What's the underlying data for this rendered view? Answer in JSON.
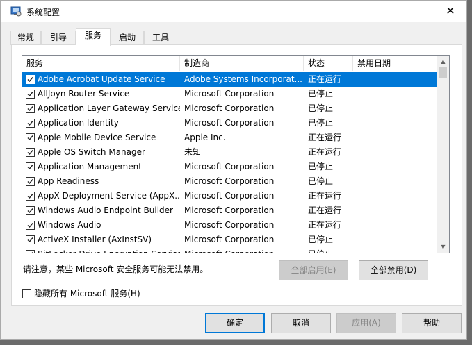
{
  "window": {
    "title": "系统配置",
    "close_glyph": "✕"
  },
  "tabs": [
    {
      "label": "常规",
      "active": false
    },
    {
      "label": "引导",
      "active": false
    },
    {
      "label": "服务",
      "active": true
    },
    {
      "label": "启动",
      "active": false
    },
    {
      "label": "工具",
      "active": false
    }
  ],
  "services": {
    "columns": [
      "服务",
      "制造商",
      "状态",
      "禁用日期"
    ],
    "rows": [
      {
        "checked": true,
        "name": "Adobe Acrobat Update Service",
        "manufacturer": "Adobe Systems Incorporat...",
        "status": "正在运行",
        "date": "",
        "selected": true
      },
      {
        "checked": true,
        "name": "AllJoyn Router Service",
        "manufacturer": "Microsoft Corporation",
        "status": "已停止",
        "date": ""
      },
      {
        "checked": true,
        "name": "Application Layer Gateway Service",
        "manufacturer": "Microsoft Corporation",
        "status": "已停止",
        "date": ""
      },
      {
        "checked": true,
        "name": "Application Identity",
        "manufacturer": "Microsoft Corporation",
        "status": "已停止",
        "date": ""
      },
      {
        "checked": true,
        "name": "Apple Mobile Device Service",
        "manufacturer": "Apple Inc.",
        "status": "正在运行",
        "date": ""
      },
      {
        "checked": true,
        "name": "Apple OS Switch Manager",
        "manufacturer": "未知",
        "status": "正在运行",
        "date": ""
      },
      {
        "checked": true,
        "name": "Application Management",
        "manufacturer": "Microsoft Corporation",
        "status": "已停止",
        "date": ""
      },
      {
        "checked": true,
        "name": "App Readiness",
        "manufacturer": "Microsoft Corporation",
        "status": "已停止",
        "date": ""
      },
      {
        "checked": true,
        "name": "AppX Deployment Service (AppX...",
        "manufacturer": "Microsoft Corporation",
        "status": "正在运行",
        "date": ""
      },
      {
        "checked": true,
        "name": "Windows Audio Endpoint Builder",
        "manufacturer": "Microsoft Corporation",
        "status": "正在运行",
        "date": ""
      },
      {
        "checked": true,
        "name": "Windows Audio",
        "manufacturer": "Microsoft Corporation",
        "status": "正在运行",
        "date": ""
      },
      {
        "checked": true,
        "name": "ActiveX Installer (AxInstSV)",
        "manufacturer": "Microsoft Corporation",
        "status": "已停止",
        "date": ""
      },
      {
        "checked": true,
        "name": "BitLocker Drive Encryption Service",
        "manufacturer": "Microsoft Corporation",
        "status": "已停止",
        "date": ""
      }
    ]
  },
  "note": "请注意，某些 Microsoft 安全服务可能无法禁用。",
  "buttons": {
    "enable_all": "全部启用(E)",
    "disable_all": "全部禁用(D)",
    "ok": "确定",
    "cancel": "取消",
    "apply": "应用(A)",
    "help": "帮助"
  },
  "hide_ms": {
    "label": "隐藏所有 Microsoft 服务(H)",
    "checked": false
  },
  "colors": {
    "selection": "#0078d7",
    "window_bg": "#f0f0f0"
  }
}
